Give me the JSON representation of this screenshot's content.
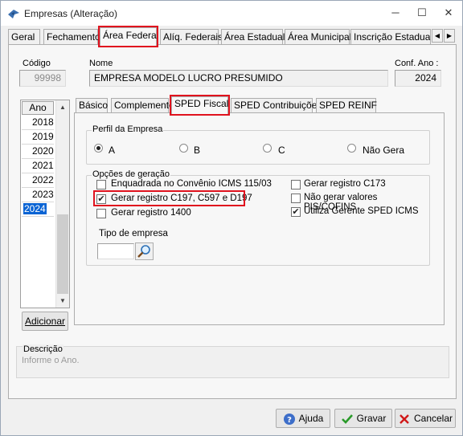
{
  "window": {
    "title": "Empresas (Alteração)",
    "minimize_glyph": "─",
    "maximize_glyph": "☐",
    "close_glyph": "✕"
  },
  "top_tabs": [
    {
      "label": "Geral"
    },
    {
      "label": "Fechamento"
    },
    {
      "label": "Área Federal"
    },
    {
      "label": "Alíq. Federais"
    },
    {
      "label": "Área Estadual"
    },
    {
      "label": "Área Municipal"
    },
    {
      "label": "Inscrição Estadual S"
    }
  ],
  "tab_scroll": {
    "left": "◀",
    "right": "▶"
  },
  "header": {
    "codigo_label": "Código",
    "codigo_value": "99998",
    "nome_label": "Nome",
    "nome_value": "EMPRESA MODELO LUCRO PRESUMIDO",
    "conf_ano_label": "Conf. Ano :",
    "conf_ano_value": "2024"
  },
  "years": {
    "header": "Ano",
    "items": [
      "2018",
      "2019",
      "2020",
      "2021",
      "2022",
      "2023",
      "2024"
    ],
    "selected": "2024",
    "scroll_up": "▲",
    "scroll_down": "▼",
    "add_button": "Adicionar"
  },
  "inner_tabs": [
    {
      "label": "Básico"
    },
    {
      "label": "Complemento"
    },
    {
      "label": "SPED Fiscal"
    },
    {
      "label": "SPED Contribuições"
    },
    {
      "label": "SPED REINF"
    }
  ],
  "perfil": {
    "title": "Perfil da Empresa",
    "options": [
      "A",
      "B",
      "C",
      "Não Gera"
    ],
    "selected": "A"
  },
  "opcoes": {
    "title": "Opções de geração",
    "left": [
      {
        "label": "Enquadrada no Convênio ICMS 115/03",
        "checked": false
      },
      {
        "label": "Gerar registro C197, C597 e D197",
        "checked": true
      },
      {
        "label": "Gerar registro 1400",
        "checked": false
      }
    ],
    "right": [
      {
        "label": "Gerar registro C173",
        "checked": false
      },
      {
        "label": "Não gerar valores PIS/COFINS",
        "checked": false
      },
      {
        "label": "Utiliza Gerente SPED ICMS",
        "checked": true
      }
    ],
    "check_glyph": "✔"
  },
  "tipo_empresa": {
    "label": "Tipo de empresa",
    "value": ""
  },
  "descricao": {
    "label": "Descrição",
    "placeholder": "Informe o Ano."
  },
  "footer": {
    "ajuda": "Ajuda",
    "gravar": "Gravar",
    "cancelar": "Cancelar"
  },
  "colors": {
    "highlight": "#e0121e",
    "selection": "#0a64d4"
  }
}
